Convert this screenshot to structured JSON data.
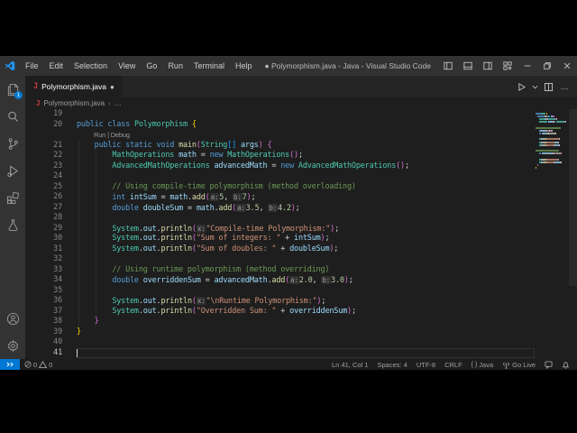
{
  "titlebar": {
    "menus": [
      "File",
      "Edit",
      "Selection",
      "View",
      "Go",
      "Run",
      "Terminal",
      "Help"
    ],
    "title": "● Polymorphism.java - Java - Visual Studio Code",
    "window_controls": [
      "toggle-sidebar",
      "toggle-panel",
      "toggle-secondary-sidebar",
      "customize-layout",
      "minimize",
      "restore",
      "close"
    ]
  },
  "tab": {
    "icon": "java-file-icon",
    "label": "Polymorphism.java",
    "dirty": "●"
  },
  "editor_actions": {
    "run": "run-java-button",
    "run_dropdown": "chevron-down-icon",
    "split": "split-editor-icon",
    "more": "more-actions-icon"
  },
  "breadcrumb": {
    "file": "Polymorphism.java",
    "sep": "›",
    "more": "…"
  },
  "activity_bar": {
    "top": [
      {
        "name": "explorer-icon",
        "badge": "1"
      },
      {
        "name": "search-icon"
      },
      {
        "name": "source-control-icon"
      },
      {
        "name": "run-debug-icon"
      },
      {
        "name": "extensions-icon"
      },
      {
        "name": "testing-icon"
      }
    ],
    "bottom": [
      {
        "name": "account-icon"
      },
      {
        "name": "settings-gear-icon"
      }
    ]
  },
  "codelens": {
    "run": "Run",
    "sep": "|",
    "debug": "Debug"
  },
  "editor": {
    "current_line": 41,
    "lines": [
      {
        "n": 19,
        "tokens": []
      },
      {
        "n": 20,
        "tokens": [
          [
            "kw",
            "public class "
          ],
          [
            "ty",
            "Polymorphism"
          ],
          [
            "pu",
            " "
          ],
          [
            "b1",
            "{"
          ]
        ]
      },
      {
        "codelens": true
      },
      {
        "n": 21,
        "tokens": [
          [
            "pu",
            "    "
          ],
          [
            "kw",
            "public static void "
          ],
          [
            "fn",
            "main"
          ],
          [
            "b2",
            "("
          ],
          [
            "ty",
            "String"
          ],
          [
            "b3",
            "[]"
          ],
          [
            "pu",
            " "
          ],
          [
            "va",
            "args"
          ],
          [
            "b2",
            ")"
          ],
          [
            "pu",
            " "
          ],
          [
            "b2",
            "{"
          ]
        ]
      },
      {
        "n": 22,
        "tokens": [
          [
            "pu",
            "        "
          ],
          [
            "ty",
            "MathOperations"
          ],
          [
            "pu",
            " "
          ],
          [
            "va",
            "math"
          ],
          [
            "pu",
            " = "
          ],
          [
            "kw",
            "new"
          ],
          [
            "pu",
            " "
          ],
          [
            "ty",
            "MathOperations"
          ],
          [
            "b2",
            "()"
          ],
          [
            "pu",
            ";"
          ]
        ]
      },
      {
        "n": 23,
        "tokens": [
          [
            "pu",
            "        "
          ],
          [
            "ty",
            "AdvancedMathOperations"
          ],
          [
            "pu",
            " "
          ],
          [
            "va",
            "advancedMath"
          ],
          [
            "pu",
            " = "
          ],
          [
            "kw",
            "new"
          ],
          [
            "pu",
            " "
          ],
          [
            "ty",
            "AdvancedMathOperations"
          ],
          [
            "b2",
            "()"
          ],
          [
            "pu",
            ";"
          ]
        ]
      },
      {
        "n": 24,
        "tokens": []
      },
      {
        "n": 25,
        "tokens": [
          [
            "co",
            "        // Using compile-time polymorphism (method overloading)"
          ]
        ]
      },
      {
        "n": 26,
        "tokens": [
          [
            "pu",
            "        "
          ],
          [
            "kw",
            "int"
          ],
          [
            "pu",
            " "
          ],
          [
            "va",
            "intSum"
          ],
          [
            "pu",
            " = "
          ],
          [
            "va",
            "math"
          ],
          [
            "pu",
            "."
          ],
          [
            "fn",
            "add"
          ],
          [
            "b2",
            "("
          ],
          [
            "hint",
            "a:"
          ],
          [
            "nu",
            "5"
          ],
          [
            "pu",
            ", "
          ],
          [
            "hint",
            "b:"
          ],
          [
            "nu",
            "7"
          ],
          [
            "b2",
            ")"
          ],
          [
            "pu",
            ";"
          ]
        ]
      },
      {
        "n": 27,
        "tokens": [
          [
            "pu",
            "        "
          ],
          [
            "kw",
            "double"
          ],
          [
            "pu",
            " "
          ],
          [
            "va",
            "doubleSum"
          ],
          [
            "pu",
            " = "
          ],
          [
            "va",
            "math"
          ],
          [
            "pu",
            "."
          ],
          [
            "fn",
            "add"
          ],
          [
            "b2",
            "("
          ],
          [
            "hint",
            "a:"
          ],
          [
            "nu",
            "3.5"
          ],
          [
            "pu",
            ", "
          ],
          [
            "hint",
            "b:"
          ],
          [
            "nu",
            "4.2"
          ],
          [
            "b2",
            ")"
          ],
          [
            "pu",
            ";"
          ]
        ]
      },
      {
        "n": 28,
        "tokens": []
      },
      {
        "n": 29,
        "tokens": [
          [
            "pu",
            "        "
          ],
          [
            "ty",
            "System"
          ],
          [
            "pu",
            "."
          ],
          [
            "va",
            "out"
          ],
          [
            "pu",
            "."
          ],
          [
            "fn",
            "println"
          ],
          [
            "b2",
            "("
          ],
          [
            "hint",
            "x:"
          ],
          [
            "st",
            "\"Compile-time Polymorphism:\""
          ],
          [
            "b2",
            ")"
          ],
          [
            "pu",
            ";"
          ]
        ]
      },
      {
        "n": 30,
        "tokens": [
          [
            "pu",
            "        "
          ],
          [
            "ty",
            "System"
          ],
          [
            "pu",
            "."
          ],
          [
            "va",
            "out"
          ],
          [
            "pu",
            "."
          ],
          [
            "fn",
            "println"
          ],
          [
            "b2",
            "("
          ],
          [
            "st",
            "\"Sum of integers: \""
          ],
          [
            "pu",
            " + "
          ],
          [
            "va",
            "intSum"
          ],
          [
            "b2",
            ")"
          ],
          [
            "pu",
            ";"
          ]
        ]
      },
      {
        "n": 31,
        "tokens": [
          [
            "pu",
            "        "
          ],
          [
            "ty",
            "System"
          ],
          [
            "pu",
            "."
          ],
          [
            "va",
            "out"
          ],
          [
            "pu",
            "."
          ],
          [
            "fn",
            "println"
          ],
          [
            "b2",
            "("
          ],
          [
            "st",
            "\"Sum of doubles: \""
          ],
          [
            "pu",
            " + "
          ],
          [
            "va",
            "doubleSum"
          ],
          [
            "b2",
            ")"
          ],
          [
            "pu",
            ";"
          ]
        ]
      },
      {
        "n": 32,
        "tokens": []
      },
      {
        "n": 33,
        "tokens": [
          [
            "co",
            "        // Using runtime polymorphism (method overriding)"
          ]
        ]
      },
      {
        "n": 34,
        "tokens": [
          [
            "pu",
            "        "
          ],
          [
            "kw",
            "double"
          ],
          [
            "pu",
            " "
          ],
          [
            "va",
            "overriddenSum"
          ],
          [
            "pu",
            " = "
          ],
          [
            "va",
            "advancedMath"
          ],
          [
            "pu",
            "."
          ],
          [
            "fn",
            "add"
          ],
          [
            "b2",
            "("
          ],
          [
            "hint",
            "a:"
          ],
          [
            "nu",
            "2.0"
          ],
          [
            "pu",
            ", "
          ],
          [
            "hint",
            "b:"
          ],
          [
            "nu",
            "3.0"
          ],
          [
            "b2",
            ")"
          ],
          [
            "pu",
            ";"
          ]
        ]
      },
      {
        "n": 35,
        "tokens": []
      },
      {
        "n": 36,
        "tokens": [
          [
            "pu",
            "        "
          ],
          [
            "ty",
            "System"
          ],
          [
            "pu",
            "."
          ],
          [
            "va",
            "out"
          ],
          [
            "pu",
            "."
          ],
          [
            "fn",
            "println"
          ],
          [
            "b2",
            "("
          ],
          [
            "hint",
            "x:"
          ],
          [
            "st",
            "\"\\nRuntime Polymorphism:\""
          ],
          [
            "b2",
            ")"
          ],
          [
            "pu",
            ";"
          ]
        ]
      },
      {
        "n": 37,
        "tokens": [
          [
            "pu",
            "        "
          ],
          [
            "ty",
            "System"
          ],
          [
            "pu",
            "."
          ],
          [
            "va",
            "out"
          ],
          [
            "pu",
            "."
          ],
          [
            "fn",
            "println"
          ],
          [
            "b2",
            "("
          ],
          [
            "st",
            "\"Overridden Sum: \""
          ],
          [
            "pu",
            " + "
          ],
          [
            "va",
            "overriddenSum"
          ],
          [
            "b2",
            ")"
          ],
          [
            "pu",
            ";"
          ]
        ]
      },
      {
        "n": 38,
        "tokens": [
          [
            "pu",
            "    "
          ],
          [
            "b2",
            "}"
          ]
        ]
      },
      {
        "n": 39,
        "tokens": [
          [
            "b1",
            "}"
          ]
        ]
      },
      {
        "n": 40,
        "tokens": []
      },
      {
        "n": 41,
        "tokens": []
      }
    ]
  },
  "status_bar": {
    "remote_icon": "remote-indicator-icon",
    "errors": "0",
    "warnings": "0",
    "right": [
      {
        "name": "cursor-position",
        "label": "Ln 41, Col 1"
      },
      {
        "name": "indentation",
        "label": "Spaces: 4"
      },
      {
        "name": "encoding",
        "label": "UTF-8"
      },
      {
        "name": "eol",
        "label": "CRLF"
      },
      {
        "name": "language-mode",
        "label": "Java",
        "icon": "braces-icon",
        "icon_text": "{ }"
      },
      {
        "name": "go-live",
        "label": "Go Live",
        "icon": "broadcast-icon"
      }
    ],
    "trailing_icons": [
      "feedback-icon",
      "bell-icon"
    ]
  },
  "colors": {
    "accent": "#0078d4",
    "editor_bg": "#1e1e1e",
    "titlebar_bg": "#323233",
    "tabbar_bg": "#252526",
    "activitybar_bg": "#333333",
    "statusbar_bg": "#1d1d1d",
    "tokens": {
      "kw": "#569CD6",
      "ty": "#4EC9B0",
      "fn": "#DCDCAA",
      "va": "#9CDCFE",
      "st": "#CE9178",
      "nu": "#B5CEA8",
      "co": "#6A9955",
      "pu": "#D4D4D4",
      "b1": "#FFD700",
      "b2": "#DA70D6",
      "b3": "#179FFF",
      "hint": "#999999"
    }
  }
}
